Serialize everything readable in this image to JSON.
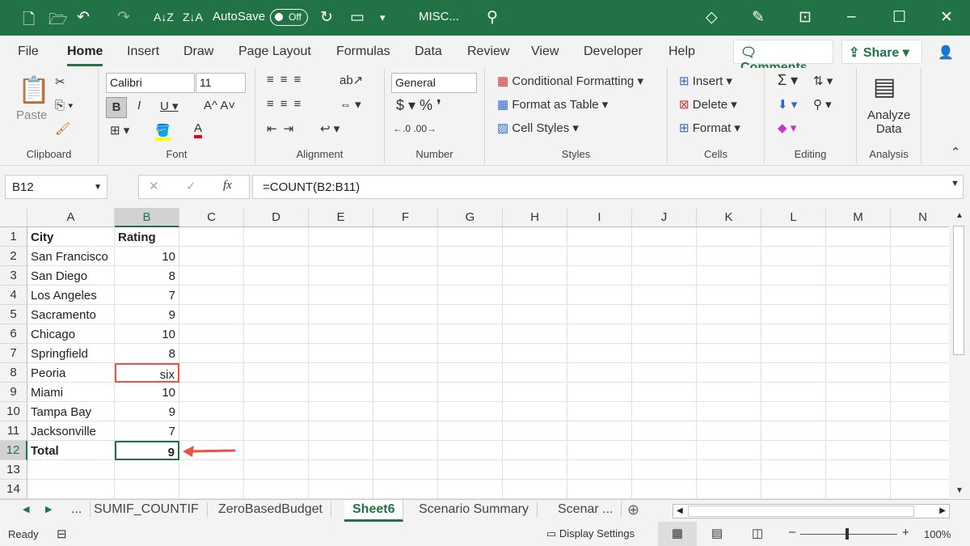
{
  "titlebar": {
    "autosave": "AutoSave",
    "toggle": "Off",
    "doc": "MISC..."
  },
  "tabs": [
    "File",
    "Home",
    "Insert",
    "Draw",
    "Page Layout",
    "Formulas",
    "Data",
    "Review",
    "View",
    "Developer",
    "Help"
  ],
  "comments": "Comments",
  "share": "Share",
  "ribbon": {
    "clipboard": {
      "label": "Clipboard",
      "paste": "Paste"
    },
    "font": {
      "label": "Font",
      "name": "Calibri",
      "size": "11"
    },
    "alignment": {
      "label": "Alignment"
    },
    "number": {
      "label": "Number",
      "format": "General"
    },
    "styles": {
      "label": "Styles",
      "cond": "Conditional Formatting",
      "table": "Format as Table",
      "cell": "Cell Styles"
    },
    "cells": {
      "label": "Cells",
      "insert": "Insert",
      "delete": "Delete",
      "format": "Format"
    },
    "editing": {
      "label": "Editing"
    },
    "analysis": {
      "label": "Analysis",
      "analyze1": "Analyze",
      "analyze2": "Data"
    }
  },
  "formula_bar": {
    "name_box": "B12",
    "fx": "fx",
    "formula": "=COUNT(B2:B11)"
  },
  "columns": [
    "A",
    "B",
    "C",
    "D",
    "E",
    "F",
    "G",
    "H",
    "I",
    "J",
    "K",
    "L",
    "M",
    "N"
  ],
  "rows": [
    [
      "City",
      "Rating"
    ],
    [
      "San Francisco",
      "10"
    ],
    [
      "San Diego",
      "8"
    ],
    [
      "Los Angeles",
      "7"
    ],
    [
      "Sacramento",
      "9"
    ],
    [
      "Chicago",
      "10"
    ],
    [
      "Springfield",
      "8"
    ],
    [
      "Peoria",
      "six"
    ],
    [
      "Miami",
      "10"
    ],
    [
      "Tampa Bay",
      "9"
    ],
    [
      "Jacksonville",
      "7"
    ],
    [
      "Total",
      "9"
    ],
    [
      "",
      ""
    ],
    [
      "",
      ""
    ]
  ],
  "sheet_tabs": [
    "...",
    "SUMIF_COUNTIF",
    "ZeroBasedBudget",
    "Sheet6",
    "Scenario Summary",
    "Scenar ..."
  ],
  "active_sheet": "Sheet6",
  "status": {
    "ready": "Ready",
    "display": "Display Settings",
    "zoom": "100%"
  },
  "colors": {
    "accent": "#217346",
    "highlight": "#e8534a"
  }
}
